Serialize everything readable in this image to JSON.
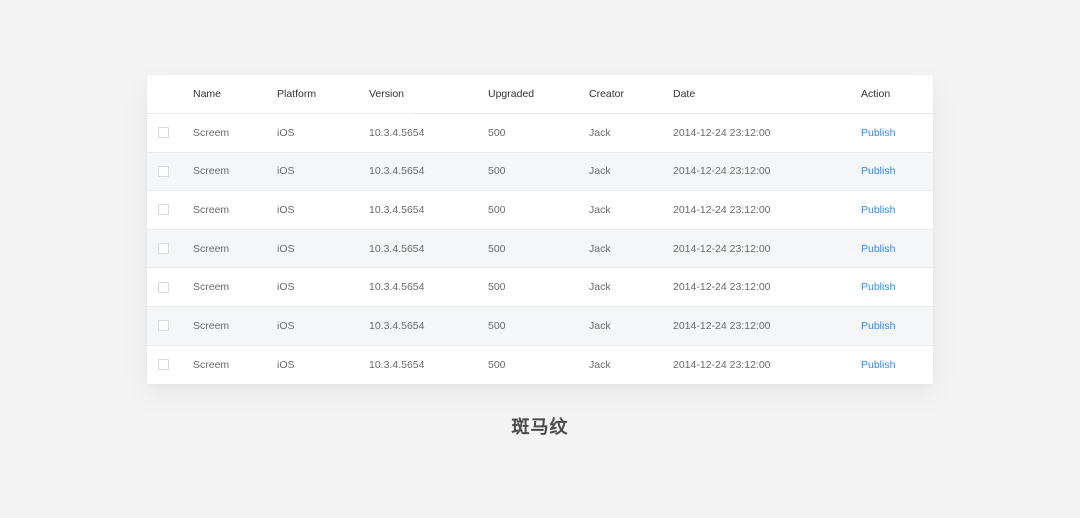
{
  "table": {
    "columns": [
      "Name",
      "Platform",
      "Version",
      "Upgraded",
      "Creator",
      "Date",
      "Action"
    ],
    "rows": [
      {
        "name": "Screem",
        "platform": "iOS",
        "version": "10.3.4.5654",
        "upgraded": "500",
        "creator": "Jack",
        "date": "2014-12-24 23:12:00",
        "action": "Publish"
      },
      {
        "name": "Screem",
        "platform": "iOS",
        "version": "10.3.4.5654",
        "upgraded": "500",
        "creator": "Jack",
        "date": "2014-12-24 23:12:00",
        "action": "Publish"
      },
      {
        "name": "Screem",
        "platform": "iOS",
        "version": "10.3.4.5654",
        "upgraded": "500",
        "creator": "Jack",
        "date": "2014-12-24 23:12:00",
        "action": "Publish"
      },
      {
        "name": "Screem",
        "platform": "iOS",
        "version": "10.3.4.5654",
        "upgraded": "500",
        "creator": "Jack",
        "date": "2014-12-24 23:12:00",
        "action": "Publish"
      },
      {
        "name": "Screem",
        "platform": "iOS",
        "version": "10.3.4.5654",
        "upgraded": "500",
        "creator": "Jack",
        "date": "2014-12-24 23:12:00",
        "action": "Publish"
      },
      {
        "name": "Screem",
        "platform": "iOS",
        "version": "10.3.4.5654",
        "upgraded": "500",
        "creator": "Jack",
        "date": "2014-12-24 23:12:00",
        "action": "Publish"
      },
      {
        "name": "Screem",
        "platform": "iOS",
        "version": "10.3.4.5654",
        "upgraded": "500",
        "creator": "Jack",
        "date": "2014-12-24 23:12:00",
        "action": "Publish"
      }
    ]
  },
  "caption": "斑马纹",
  "colors": {
    "background": "#f4f4f5",
    "zebra_row": "#f5f6f8",
    "link": "#2d8cf0"
  }
}
